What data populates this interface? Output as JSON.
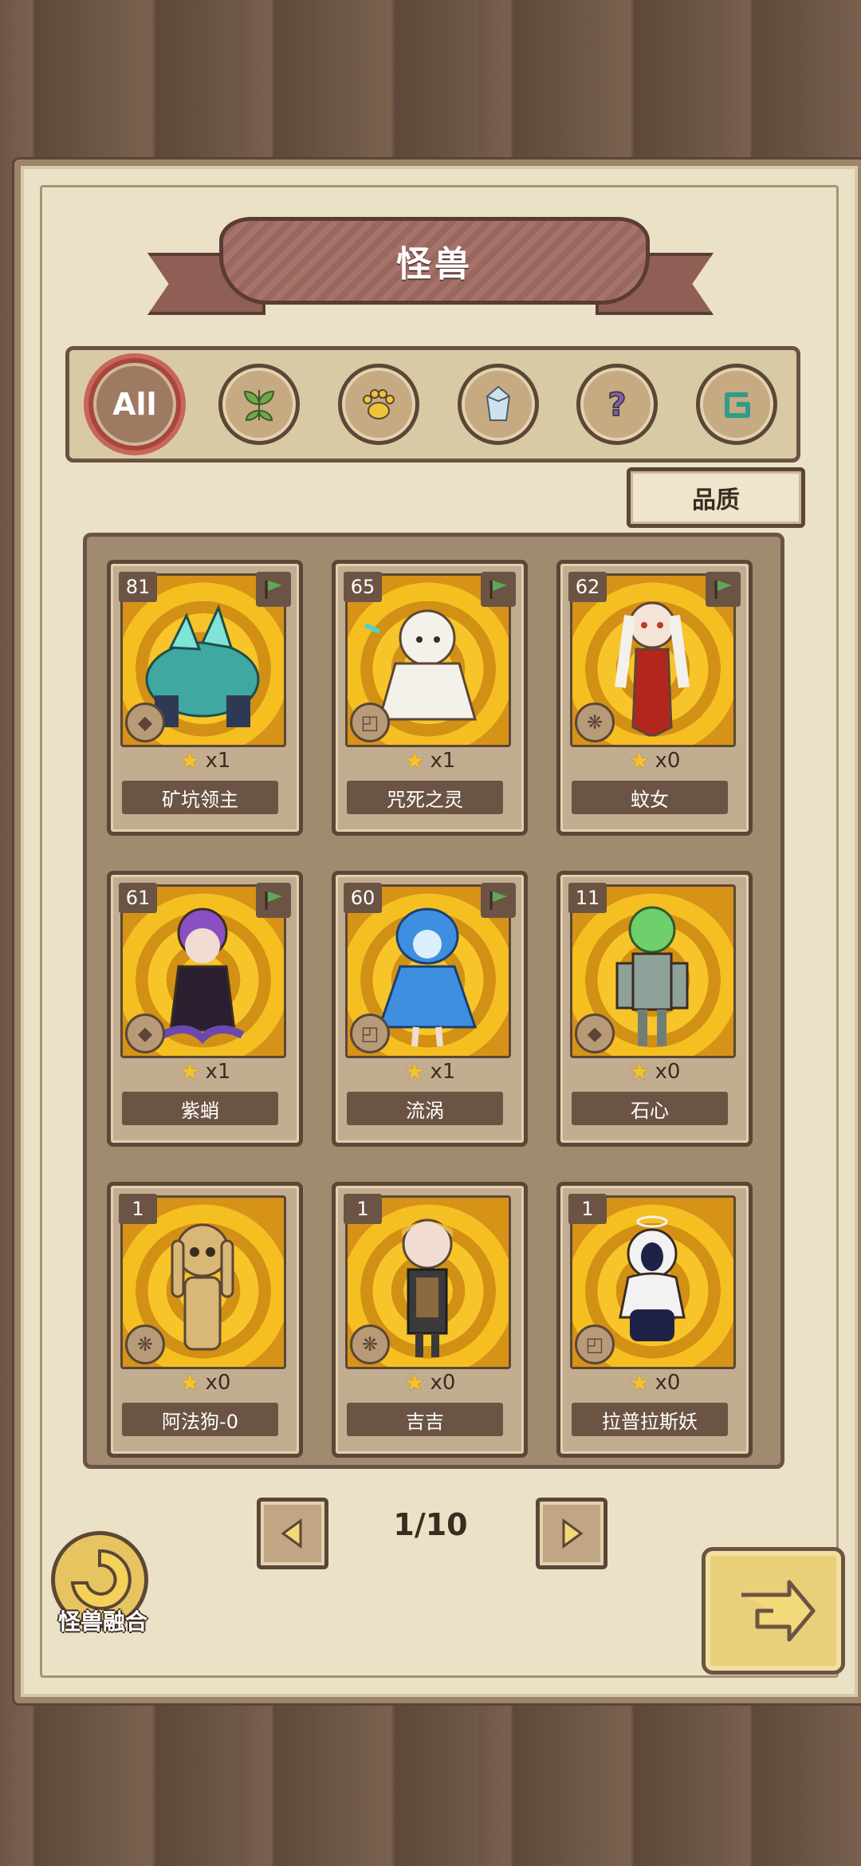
{
  "header": {
    "title": "怪兽"
  },
  "filters": [
    {
      "name": "all",
      "label": "All",
      "icon": "all-badge",
      "active": true
    },
    {
      "name": "plant",
      "icon": "leaf-icon"
    },
    {
      "name": "beast",
      "icon": "paw-icon"
    },
    {
      "name": "mineral",
      "icon": "crystal-icon"
    },
    {
      "name": "unknown",
      "icon": "question-icon"
    },
    {
      "name": "spirit",
      "icon": "swirl-icon"
    }
  ],
  "quality_button": {
    "label": "品质"
  },
  "monsters": [
    {
      "level": "81",
      "count": "x1",
      "name": "矿坑领主",
      "type": "crystal-icon",
      "flag": true,
      "body": "#3fa8a0"
    },
    {
      "level": "65",
      "count": "x1",
      "name": "咒死之灵",
      "type": "swirl-icon",
      "flag": true,
      "body": "#f4f1ea"
    },
    {
      "level": "62",
      "count": "x0",
      "name": "蚊女",
      "type": "paw-icon",
      "flag": true,
      "body": "#b3261e"
    },
    {
      "level": "61",
      "count": "x1",
      "name": "紫蛸",
      "type": "crystal-icon",
      "flag": true,
      "body": "#5b2d86"
    },
    {
      "level": "60",
      "count": "x1",
      "name": "流涡",
      "type": "swirl-icon",
      "flag": true,
      "body": "#3e8fe0"
    },
    {
      "level": "11",
      "count": "x0",
      "name": "石心",
      "type": "crystal-icon",
      "flag": false,
      "body": "#8fa29a"
    },
    {
      "level": "1",
      "count": "x0",
      "name": "阿法狗-0",
      "type": "paw-icon",
      "flag": false,
      "body": "#d8b777"
    },
    {
      "level": "1",
      "count": "x0",
      "name": "吉吉",
      "type": "paw-icon",
      "flag": false,
      "body": "#3a3a3a"
    },
    {
      "level": "1",
      "count": "x0",
      "name": "拉普拉斯妖",
      "type": "swirl-icon",
      "flag": false,
      "body": "#f2f2f2"
    }
  ],
  "pagination": {
    "page": "1/10"
  },
  "fusion": {
    "label": "怪兽融合"
  },
  "colors": {
    "accent": "#a8463a",
    "panel": "#a08a70",
    "card_art": "#f7c52a"
  }
}
